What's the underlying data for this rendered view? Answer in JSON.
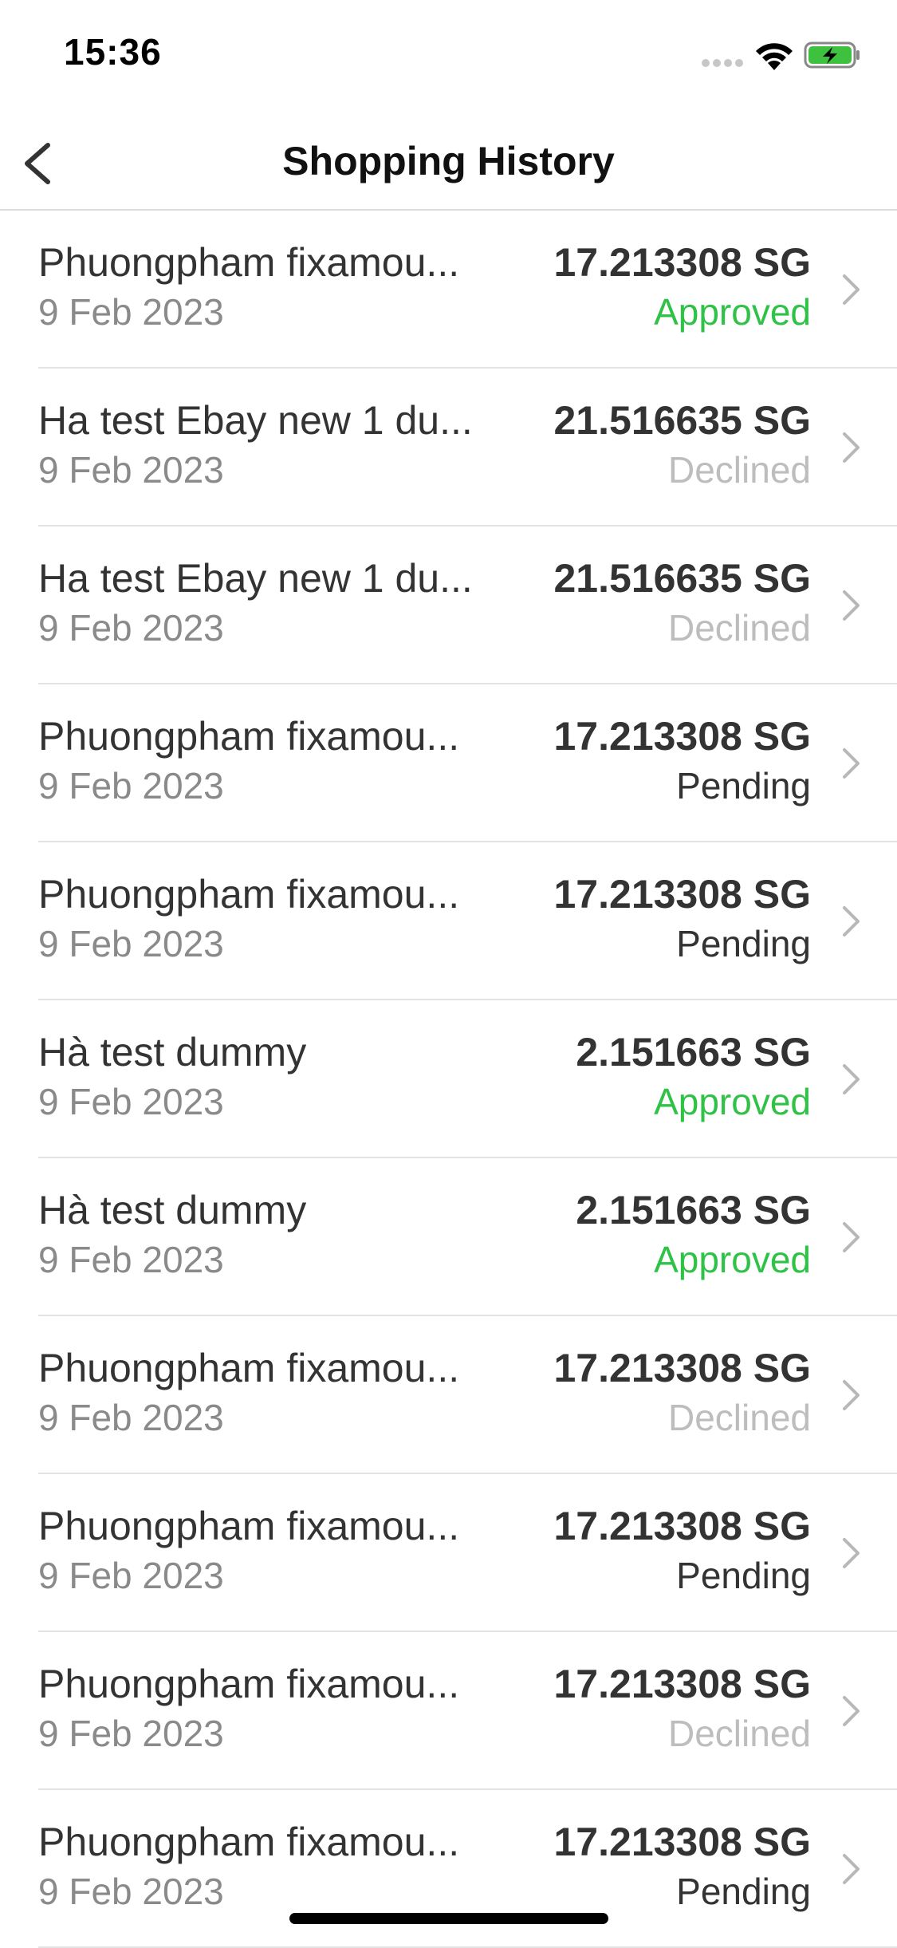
{
  "status_bar": {
    "time": "15:36",
    "icons": [
      "signal-dots-icon",
      "wifi-icon",
      "battery-charging-icon"
    ],
    "battery_color": "#3ec13e"
  },
  "nav": {
    "title": "Shopping History",
    "back_icon": "chevron-left-icon"
  },
  "colors": {
    "approved": "#2fc247",
    "declined": "#bdbdbd",
    "pending": "#333333"
  },
  "transactions": [
    {
      "name": "Phuongpham fixamou...",
      "date": "9 Feb 2023",
      "amount": "17.213308 SG",
      "status": "Approved",
      "status_type": "approved"
    },
    {
      "name": "Ha test Ebay new 1 du...",
      "date": "9 Feb 2023",
      "amount": "21.516635 SG",
      "status": "Declined",
      "status_type": "declined"
    },
    {
      "name": "Ha test Ebay new 1 du...",
      "date": "9 Feb 2023",
      "amount": "21.516635 SG",
      "status": "Declined",
      "status_type": "declined"
    },
    {
      "name": "Phuongpham fixamou...",
      "date": "9 Feb 2023",
      "amount": "17.213308 SG",
      "status": "Pending",
      "status_type": "pending"
    },
    {
      "name": "Phuongpham fixamou...",
      "date": "9 Feb 2023",
      "amount": "17.213308 SG",
      "status": "Pending",
      "status_type": "pending"
    },
    {
      "name": "Hà test dummy",
      "date": "9 Feb 2023",
      "amount": "2.151663 SG",
      "status": "Approved",
      "status_type": "approved"
    },
    {
      "name": "Hà test dummy",
      "date": "9 Feb 2023",
      "amount": "2.151663 SG",
      "status": "Approved",
      "status_type": "approved"
    },
    {
      "name": "Phuongpham fixamou...",
      "date": "9 Feb 2023",
      "amount": "17.213308 SG",
      "status": "Declined",
      "status_type": "declined"
    },
    {
      "name": "Phuongpham fixamou...",
      "date": "9 Feb 2023",
      "amount": "17.213308 SG",
      "status": "Pending",
      "status_type": "pending"
    },
    {
      "name": "Phuongpham fixamou...",
      "date": "9 Feb 2023",
      "amount": "17.213308 SG",
      "status": "Declined",
      "status_type": "declined"
    },
    {
      "name": "Phuongpham fixamou...",
      "date": "9 Feb 2023",
      "amount": "17.213308 SG",
      "status": "Pending",
      "status_type": "pending"
    }
  ]
}
